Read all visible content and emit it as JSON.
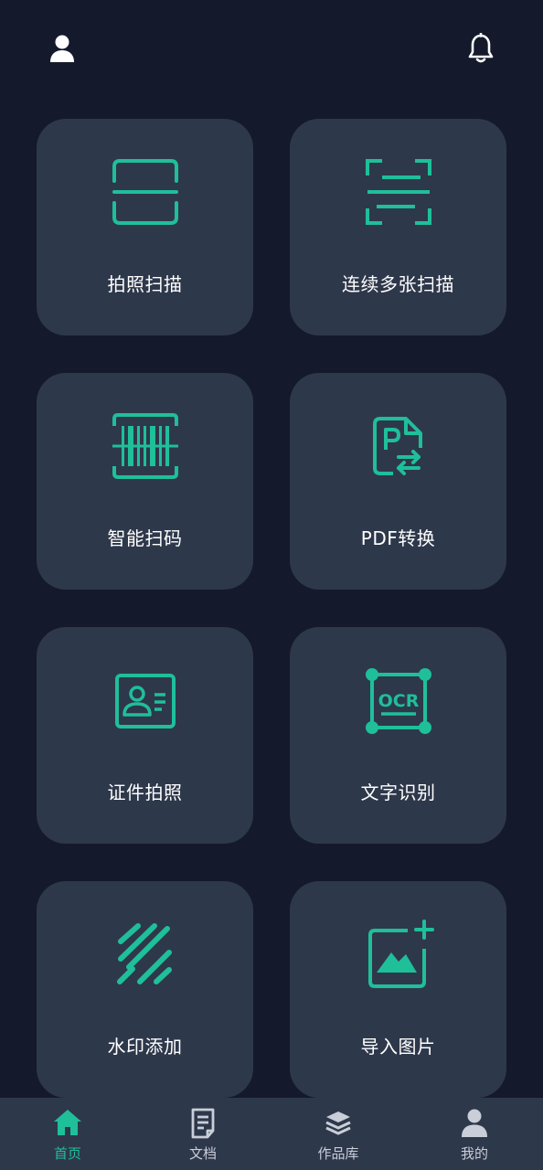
{
  "colors": {
    "background": "#141a2b",
    "card": "#2e384b",
    "accent": "#1fbf9a",
    "text": "#ffffff",
    "tab_inactive": "#c9ced8"
  },
  "header": {
    "left_icon": "user-icon",
    "right_icon": "bell-icon"
  },
  "features": [
    {
      "label": "拍照扫描",
      "icon": "scan-frame-icon"
    },
    {
      "label": "连续多张扫描",
      "icon": "multi-scan-icon"
    },
    {
      "label": "智能扫码",
      "icon": "barcode-scan-icon"
    },
    {
      "label": "PDF转换",
      "icon": "pdf-convert-icon"
    },
    {
      "label": "证件拍照",
      "icon": "id-card-icon"
    },
    {
      "label": "文字识别",
      "icon": "ocr-icon"
    },
    {
      "label": "水印添加",
      "icon": "watermark-icon"
    },
    {
      "label": "导入图片",
      "icon": "import-image-icon"
    }
  ],
  "tabs": [
    {
      "label": "首页",
      "icon": "home-icon",
      "active": true
    },
    {
      "label": "文档",
      "icon": "document-icon",
      "active": false
    },
    {
      "label": "作品库",
      "icon": "layers-icon",
      "active": false
    },
    {
      "label": "我的",
      "icon": "profile-icon",
      "active": false
    }
  ]
}
